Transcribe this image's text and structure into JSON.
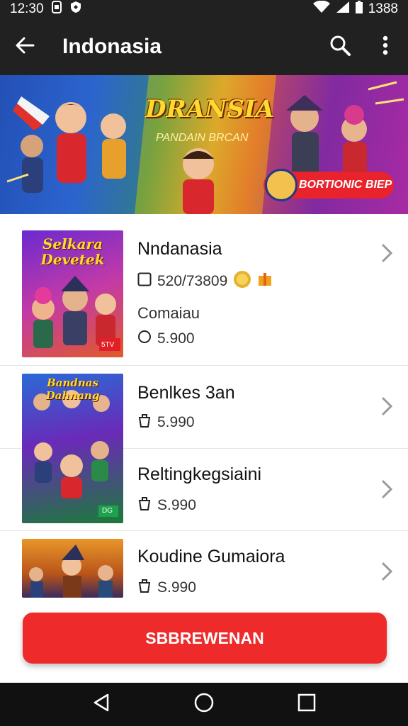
{
  "status_bar": {
    "time": "12:30",
    "battery": "1388"
  },
  "app_bar": {
    "title": "Indonasia"
  },
  "hero": {
    "title": "DRANSIA",
    "subtitle": "PANDAIN BRCAN",
    "button_label": "BORTIONIC BIEP"
  },
  "items": [
    {
      "title": "Nndanasia",
      "meta": "520/73809",
      "subtitle": "Comaiau",
      "price": "5.900",
      "thumb_text": "Selkara Devetek",
      "badge": "5TV"
    },
    {
      "title": "Benlkes 3an",
      "price": "5.990",
      "thumb_text": "Bandnas Dahnang",
      "badge": "DG"
    },
    {
      "title": "Reltingkegsiaini",
      "price": "S.990"
    },
    {
      "title": "Koudine Gumaiora",
      "price": "S.990"
    }
  ],
  "cta": {
    "label": "SBBREWENAN"
  },
  "colors": {
    "accent": "#ee2a2a",
    "app_bar": "#212121"
  },
  "icons": [
    "back-arrow-icon",
    "search-icon",
    "more-vert-icon",
    "chevron-right-icon",
    "cart-icon",
    "nav-back-icon",
    "nav-home-icon",
    "nav-recents-icon"
  ]
}
